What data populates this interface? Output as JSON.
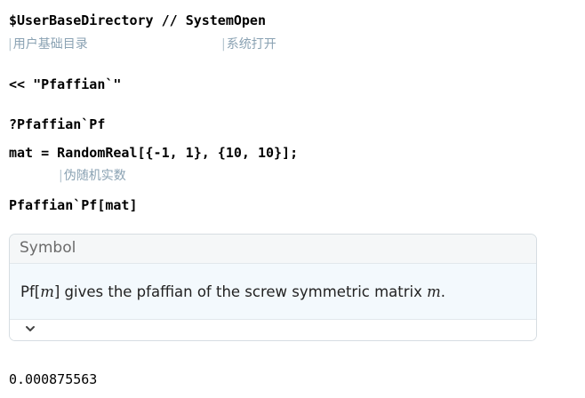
{
  "cell1": {
    "code_part1": "$UserBaseDirectory",
    "operator": " // ",
    "code_part2": "SystemOpen",
    "anno_left": "用户基础目录",
    "anno_right": "系统打开"
  },
  "cell2": {
    "code": "<< \"Pfaffian`\""
  },
  "cell3": {
    "code": "?Pfaffian`Pf"
  },
  "cell4": {
    "code": "mat = RandomReal[{-1, 1}, {10, 10}];",
    "anno": "伪随机实数"
  },
  "cell5": {
    "code": "Pfaffian`Pf[mat]"
  },
  "symbol_card": {
    "header": "Symbol",
    "usage_func": "Pf[",
    "usage_arg": "m",
    "usage_close": "]",
    "usage_text": " gives the pfaffian of the screw symmetric matrix ",
    "usage_arg2": "m",
    "usage_end": ".",
    "expand_icon": "chevron-down-icon"
  },
  "output": {
    "value": "0.000875563"
  }
}
